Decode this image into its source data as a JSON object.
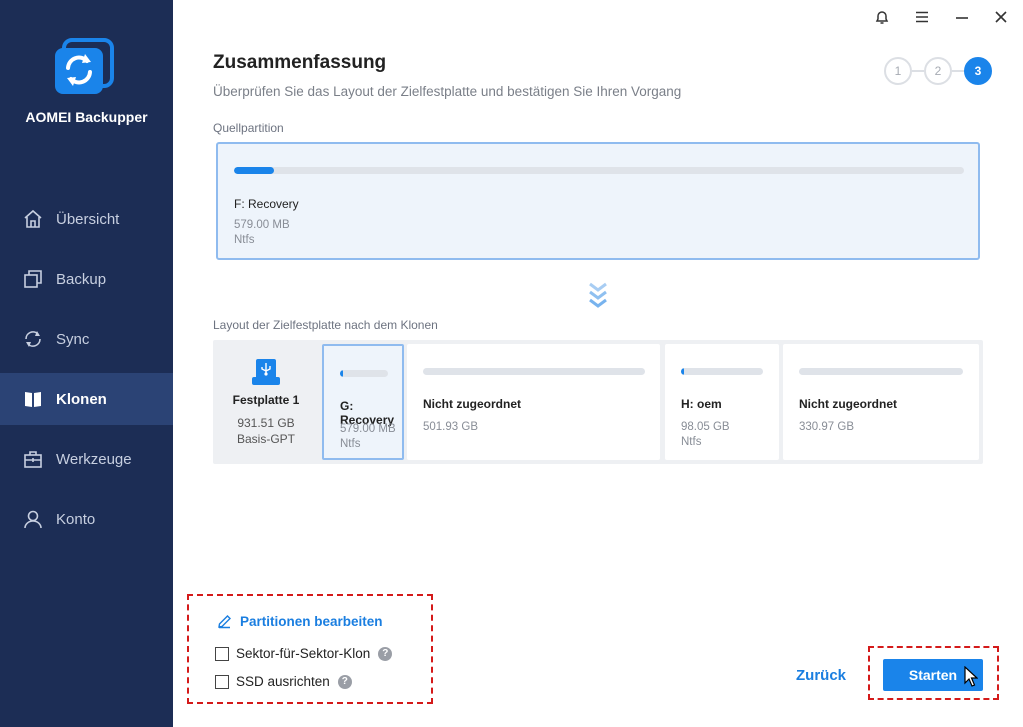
{
  "app": {
    "title": "AOMEI Backupper"
  },
  "sidebar": {
    "items": [
      {
        "label": "Übersicht",
        "icon": "home-icon"
      },
      {
        "label": "Backup",
        "icon": "backup-icon"
      },
      {
        "label": "Sync",
        "icon": "sync-icon"
      },
      {
        "label": "Klonen",
        "icon": "clone-icon",
        "active": true
      },
      {
        "label": "Werkzeuge",
        "icon": "toolbox-icon"
      },
      {
        "label": "Konto",
        "icon": "user-icon"
      }
    ]
  },
  "window_controls": [
    "bell-icon",
    "menu-icon",
    "minimize-icon",
    "close-icon"
  ],
  "header": {
    "title": "Zusammenfassung",
    "subtitle": "Überprüfen Sie das Layout der Zielfestplatte und bestätigen Sie Ihren Vorgang",
    "steps": [
      "1",
      "2",
      "3"
    ],
    "active_step": 3
  },
  "source": {
    "label": "Quellpartition",
    "partition": {
      "name": "F: Recovery",
      "size": "579.00 MB",
      "fs": "Ntfs",
      "usage": 0.055
    }
  },
  "destination": {
    "label": "Layout der Zielfestplatte nach dem Klonen",
    "disk": {
      "name": "Festplatte 1",
      "size": "931.51 GB",
      "type": "Basis-GPT"
    },
    "partitions": [
      {
        "name": "G: Recovery",
        "size": "579.00 MB",
        "fs": "Ntfs",
        "usage": 0.06
      },
      {
        "name": "Nicht zugeordnet",
        "size": "501.93 GB",
        "fs": "",
        "usage": 0
      },
      {
        "name": "H: oem",
        "size": "98.05 GB",
        "fs": "Ntfs",
        "usage": 0.04
      },
      {
        "name": "Nicht zugeordnet",
        "size": "330.97 GB",
        "fs": "",
        "usage": 0
      }
    ]
  },
  "options": {
    "edit_partitions": "Partitionen bearbeiten",
    "sector_clone": "Sektor-für-Sektor-Klon",
    "ssd_align": "SSD ausrichten",
    "help_glyph": "?"
  },
  "footer": {
    "back": "Zurück",
    "start": "Starten"
  },
  "colors": {
    "accent": "#1a84ea",
    "sidebar": "#1c2d55",
    "highlight": "#d41a1a"
  }
}
